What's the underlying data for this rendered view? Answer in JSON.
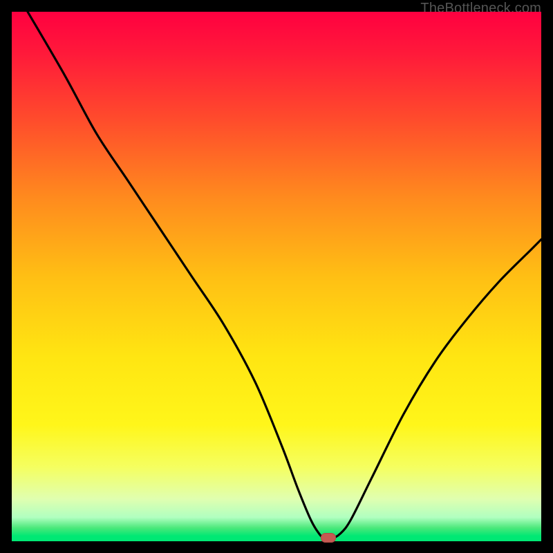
{
  "watermark": "TheBottleneck.com",
  "colors": {
    "gradient_stops": [
      {
        "offset": 0.0,
        "color": "#ff0040"
      },
      {
        "offset": 0.08,
        "color": "#ff1a3a"
      },
      {
        "offset": 0.2,
        "color": "#ff4a2c"
      },
      {
        "offset": 0.35,
        "color": "#ff8a1e"
      },
      {
        "offset": 0.5,
        "color": "#ffbf14"
      },
      {
        "offset": 0.65,
        "color": "#ffe512"
      },
      {
        "offset": 0.78,
        "color": "#fff61a"
      },
      {
        "offset": 0.86,
        "color": "#f5ff60"
      },
      {
        "offset": 0.92,
        "color": "#e0ffb0"
      },
      {
        "offset": 0.955,
        "color": "#b0ffc0"
      },
      {
        "offset": 0.975,
        "color": "#4ae87a"
      },
      {
        "offset": 0.99,
        "color": "#00e874"
      },
      {
        "offset": 1.0,
        "color": "#00e874"
      }
    ],
    "curve": "#000000",
    "marker_fill": "#c45a52",
    "marker_stroke": "#b14a44",
    "background": "#000000"
  },
  "chart_data": {
    "type": "line",
    "title": "",
    "xlabel": "",
    "ylabel": "",
    "xlim": [
      0,
      100
    ],
    "ylim": [
      0,
      100
    ],
    "grid": false,
    "legend": false,
    "series": [
      {
        "name": "bottleneck-curve",
        "x": [
          3,
          10,
          16,
          22,
          28,
          34,
          40,
          46,
          51,
          54,
          56.5,
          58,
          59,
          60.5,
          62,
          64,
          68,
          74,
          80,
          86,
          92,
          98,
          100
        ],
        "values": [
          100,
          88,
          77,
          68,
          59,
          50,
          41,
          30,
          18,
          10,
          4,
          1.5,
          0.6,
          0.6,
          1.4,
          4,
          12,
          24,
          34,
          42,
          49,
          55,
          57
        ]
      }
    ],
    "marker": {
      "x": 59.8,
      "y": 0.6
    }
  }
}
